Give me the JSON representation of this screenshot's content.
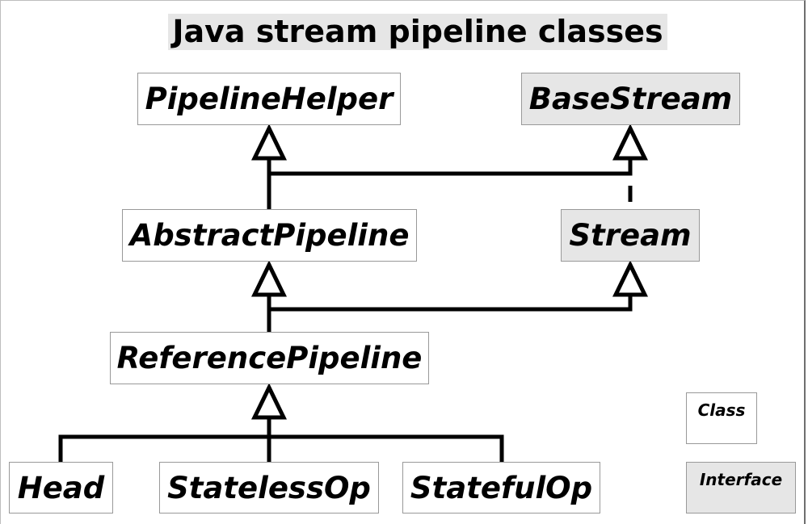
{
  "title": "Java stream pipeline classes",
  "nodes": {
    "pipeline_helper": {
      "label": "PipelineHelper",
      "kind": "class"
    },
    "base_stream": {
      "label": "BaseStream",
      "kind": "interface"
    },
    "abstract_pipeline": {
      "label": "AbstractPipeline",
      "kind": "class"
    },
    "stream": {
      "label": "Stream",
      "kind": "interface"
    },
    "reference_pipeline": {
      "label": "ReferencePipeline",
      "kind": "class"
    },
    "head": {
      "label": "Head",
      "kind": "class"
    },
    "stateless_op": {
      "label": "StatelessOp",
      "kind": "class"
    },
    "stateful_op": {
      "label": "StatefulOp",
      "kind": "class"
    }
  },
  "edges": [
    {
      "from": "abstract_pipeline",
      "to": "pipeline_helper",
      "type": "extends"
    },
    {
      "from": "abstract_pipeline",
      "to": "base_stream",
      "type": "implements"
    },
    {
      "from": "stream",
      "to": "base_stream",
      "type": "extends-interface"
    },
    {
      "from": "reference_pipeline",
      "to": "abstract_pipeline",
      "type": "extends"
    },
    {
      "from": "reference_pipeline",
      "to": "stream",
      "type": "implements"
    },
    {
      "from": "head",
      "to": "reference_pipeline",
      "type": "extends"
    },
    {
      "from": "stateless_op",
      "to": "reference_pipeline",
      "type": "extends"
    },
    {
      "from": "stateful_op",
      "to": "reference_pipeline",
      "type": "extends"
    }
  ],
  "legend": {
    "class_label": "Class",
    "interface_label": "Interface"
  },
  "colors": {
    "interface_fill": "#e6e6e6",
    "class_fill": "#ffffff",
    "line": "#000000"
  }
}
